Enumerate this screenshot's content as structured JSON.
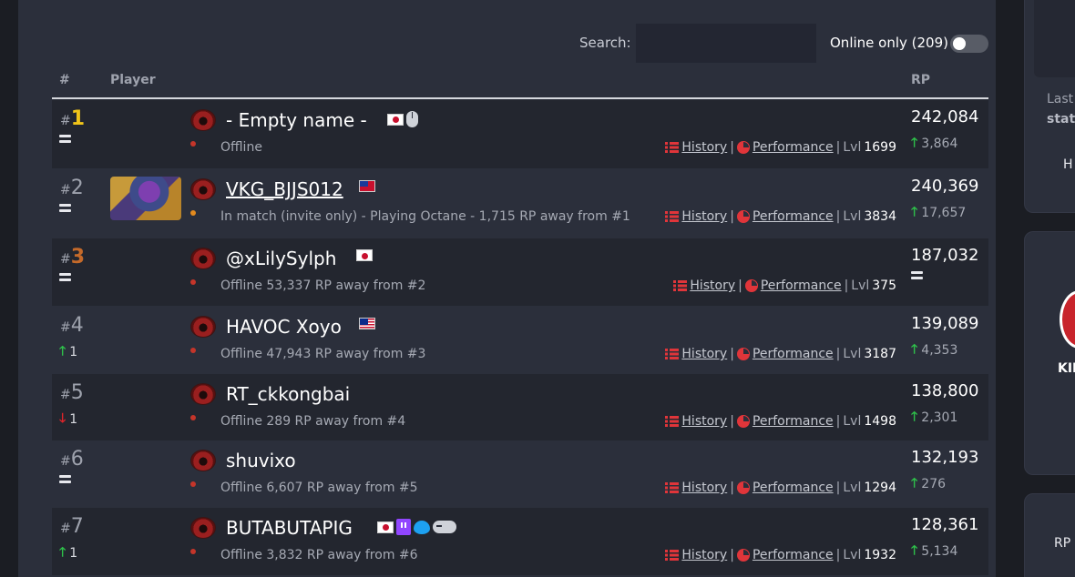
{
  "search": {
    "label": "Search:",
    "value": ""
  },
  "online_filter": {
    "label": "Online only (209)",
    "enabled": false
  },
  "table_headers": {
    "rank": "#",
    "player": "Player",
    "rp": "RP"
  },
  "links": {
    "history": "History",
    "performance": "Performance",
    "separator": "|",
    "lvl_prefix": "Lvl"
  },
  "rows": [
    {
      "hash": "#",
      "rank": "1",
      "change": "",
      "change_dir": "same",
      "name": "- Empty name -",
      "status": "Offline",
      "lvl": "1699",
      "rp": "242,084",
      "rp_change": "3,864"
    },
    {
      "hash": "#",
      "rank": "2",
      "change": "",
      "change_dir": "same",
      "name": "VKG_BJJS012",
      "status": "In match (invite only) - Playing Octane - 1,715 RP away from #1",
      "lvl": "3834",
      "rp": "240,369",
      "rp_change": "17,657"
    },
    {
      "hash": "#",
      "rank": "3",
      "change": "",
      "change_dir": "same",
      "name": "@xLilySylph",
      "status": "Offline 53,337 RP away from #2",
      "lvl": "375",
      "rp": "187,032",
      "rp_change": ""
    },
    {
      "hash": "#",
      "rank": "4",
      "change": "1",
      "change_dir": "up",
      "name": "HAVOC Xoyo",
      "status": "Offline 47,943 RP away from #3",
      "lvl": "3187",
      "rp": "139,089",
      "rp_change": "4,353"
    },
    {
      "hash": "#",
      "rank": "5",
      "change": "1",
      "change_dir": "down",
      "name": "RT_ckkongbai",
      "status": "Offline 289 RP away from #4",
      "lvl": "1498",
      "rp": "138,800",
      "rp_change": "2,301"
    },
    {
      "hash": "#",
      "rank": "6",
      "change": "",
      "change_dir": "same",
      "name": "shuvixo",
      "status": "Offline 6,607 RP away from #5",
      "lvl": "1294",
      "rp": "132,193",
      "rp_change": "276"
    },
    {
      "hash": "#",
      "rank": "7",
      "change": "1",
      "change_dir": "up",
      "name": "BUTABUTAPIG",
      "status": "Offline 3,832 RP away from #6",
      "lvl": "1932",
      "rp": "128,361",
      "rp_change": "5,134"
    }
  ],
  "side": {
    "last_text": "Last",
    "stat_text": "stat",
    "h_text": "H",
    "kin_text": "KIN",
    "rp_text": "RP"
  },
  "icons": {
    "rank_same": "equals-icon",
    "rank_up": "arrow-up-icon",
    "rank_down": "arrow-down-icon",
    "history": "list-icon",
    "performance": "pie-chart-icon",
    "platform_pc": "mouse-icon",
    "twitch": "twitch-icon",
    "twitter": "twitter-icon",
    "console": "gamepad-icon"
  },
  "colors": {
    "rank1": "#f0c419",
    "rank3": "#c56a2a",
    "up": "#2ec04a",
    "down": "#e0242a",
    "link_icon": "#e0353a",
    "offline_dot": "#c4352a",
    "in_match_dot": "#e38a1e"
  }
}
